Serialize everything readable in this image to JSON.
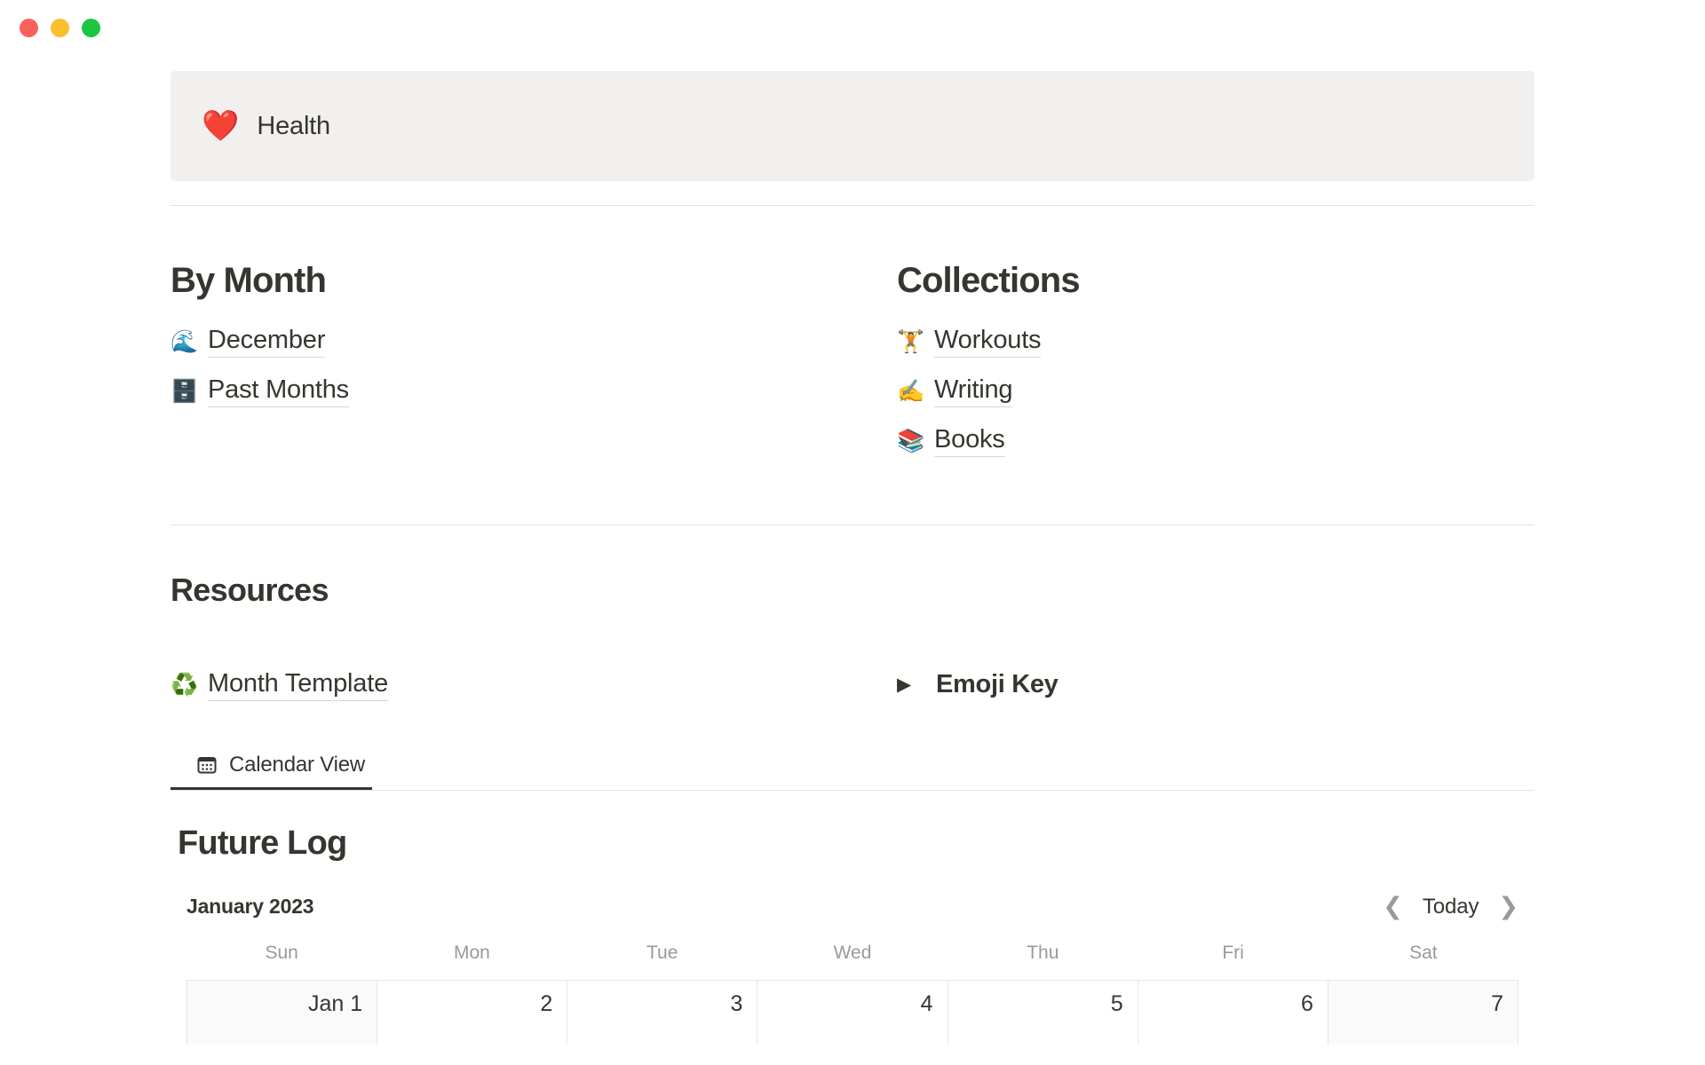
{
  "window": {
    "traffic_lights": [
      {
        "name": "close",
        "color": "#fa6159"
      },
      {
        "name": "minimize",
        "color": "#fbbe2f"
      },
      {
        "name": "maximize",
        "color": "#1bc642"
      }
    ]
  },
  "header": {
    "emoji": "❤️",
    "emoji_name": "red-heart-emoji",
    "title": "Health"
  },
  "by_month": {
    "heading": "By Month",
    "links": [
      {
        "emoji": "🌊",
        "emoji_name": "water-wave-emoji",
        "label": "December"
      },
      {
        "emoji": "🗄️",
        "emoji_name": "file-cabinet-emoji",
        "label": "Past Months"
      }
    ]
  },
  "collections": {
    "heading": "Collections",
    "links": [
      {
        "emoji": "🏋️",
        "emoji_name": "weight-lifter-emoji",
        "label": "Workouts"
      },
      {
        "emoji": "✍️",
        "emoji_name": "writing-hand-emoji",
        "label": "Writing"
      },
      {
        "emoji": "📚",
        "emoji_name": "books-emoji",
        "label": "Books"
      }
    ]
  },
  "resources": {
    "heading": "Resources",
    "month_template": {
      "emoji": "♻️",
      "emoji_name": "recycling-symbol-emoji",
      "label": "Month Template"
    },
    "emoji_key_toggle": {
      "triangle": "▶",
      "triangle_name": "collapsed-toggle-triangle-icon",
      "label": "Emoji Key"
    }
  },
  "tabs": [
    {
      "label": "Calendar View",
      "icon": "calendar-icon",
      "active": true
    }
  ],
  "future_log": {
    "title": "Future Log",
    "month_label": "January 2023",
    "today_label": "Today",
    "prev_icon": "chevron-left-icon",
    "next_icon": "chevron-right-icon",
    "weekday_headers": [
      "Sun",
      "Mon",
      "Tue",
      "Wed",
      "Thu",
      "Fri",
      "Sat"
    ],
    "first_row": [
      {
        "label": "Jan 1",
        "weekend": true
      },
      {
        "label": "2",
        "weekend": false
      },
      {
        "label": "3",
        "weekend": false
      },
      {
        "label": "4",
        "weekend": false
      },
      {
        "label": "5",
        "weekend": false
      },
      {
        "label": "6",
        "weekend": false
      },
      {
        "label": "7",
        "weekend": true
      }
    ]
  },
  "colors": {
    "text": "#37352f",
    "muted": "#9b9a97",
    "callout_bg": "#f1f0ee",
    "divider": "#e3e2e0",
    "grid_line": "#e7e6e4",
    "weekend_bg": "#fafafa"
  }
}
